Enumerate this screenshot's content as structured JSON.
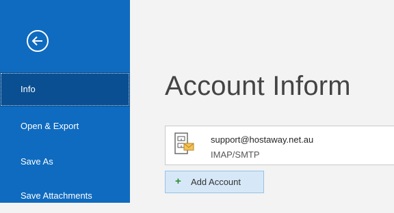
{
  "sidebar": {
    "back_icon": "back-arrow-circle-icon",
    "items": [
      {
        "label": "Info",
        "active": true
      },
      {
        "label": "Open & Export",
        "active": false
      },
      {
        "label": "Save As",
        "active": false
      },
      {
        "label": "Save Attachments",
        "active": false
      }
    ]
  },
  "main": {
    "title": "Account Inform",
    "account": {
      "email": "support@hostaway.net.au",
      "type": "IMAP/SMTP",
      "icon": "mail-account-icon"
    },
    "add_account": {
      "label": "Add Account",
      "icon": "plus-icon"
    }
  },
  "colors": {
    "sidebar_bg": "#0f6bbf",
    "active_item_bg": "#0a4f91",
    "content_bg": "#f3f3f3",
    "add_button_bg": "#d6e8f7",
    "plus_green": "#2f8a2f"
  }
}
